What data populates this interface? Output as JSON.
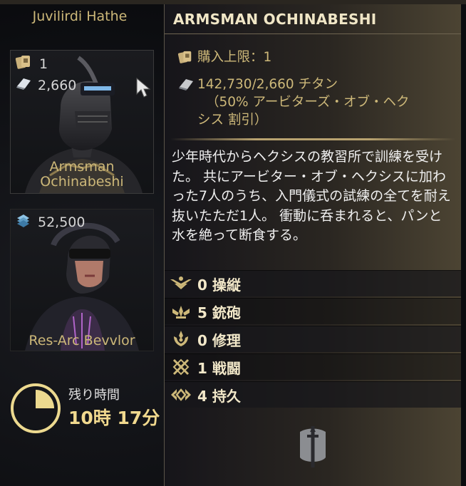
{
  "colors": {
    "gold": "#cdb879",
    "title": "#f0e6c6",
    "timer_value": "#f1d98e"
  },
  "left_panel": {
    "top_card_name": "Juvilirdi Hathe",
    "cards": [
      {
        "name": "Armsman Ochinabeshi",
        "limit_icon": "card-icon",
        "limit_count": "1",
        "cost_icon": "titanium-icon",
        "cost": "2,660"
      },
      {
        "name": "Res-Arc Bevvlor",
        "cost_icon": "currency-icon",
        "cost": "52,500"
      }
    ],
    "timer": {
      "icon": "clock-icon",
      "label": "残り時間",
      "value": "10時 17分",
      "progress_fraction": 0.25
    }
  },
  "tooltip": {
    "title": "ARMSMAN OCHINABESHI",
    "purchase_limit": "購入上限：1",
    "cost_line1": "142,730/2,660 チタン",
    "cost_line2": "（50% アービターズ・オブ・ヘク",
    "cost_line3": "シス 割引）",
    "description": "少年時代からヘクシスの教習所で訓練を受けた。 共にアービター・オブ・ヘクシスに加わった7人のうち、入門儀式の試練の全てを耐え抜いたただ1人。 衝動に呑まれると、パンと水を絶って断食する。",
    "stats": [
      {
        "icon": "piloting-icon",
        "label": "0 操縦"
      },
      {
        "icon": "gunnery-icon",
        "label": "5 銃砲"
      },
      {
        "icon": "engineering-icon",
        "label": "0 修理"
      },
      {
        "icon": "combat-icon",
        "label": "1 戦闘"
      },
      {
        "icon": "endurance-icon",
        "label": "4 持久"
      }
    ],
    "faction_icon": "arbiters-of-hexis-icon"
  }
}
